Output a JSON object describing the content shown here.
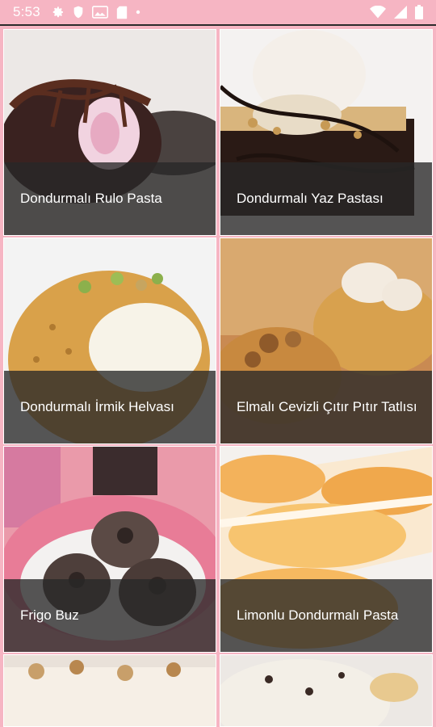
{
  "status_bar": {
    "time": "5:53",
    "left_icons": [
      "gear-icon",
      "shield-icon",
      "gallery-icon",
      "sd-card-icon",
      "dot-icon"
    ],
    "right_icons": [
      "wifi-icon",
      "signal-icon",
      "battery-icon"
    ],
    "background": "#f6b5c3"
  },
  "recipes": [
    {
      "title": "Dondurmalı Rulo Pasta"
    },
    {
      "title": "Dondurmalı Yaz Pastası"
    },
    {
      "title": "Dondurmalı İrmik Helvası"
    },
    {
      "title": "Elmalı Cevizli Çıtır Pıtır Tatlısı"
    },
    {
      "title": "Frigo Buz"
    },
    {
      "title": "Limonlu Dondurmalı Pasta"
    }
  ],
  "colors": {
    "accent": "#f6b5c3",
    "caption_overlay": "#282828"
  }
}
